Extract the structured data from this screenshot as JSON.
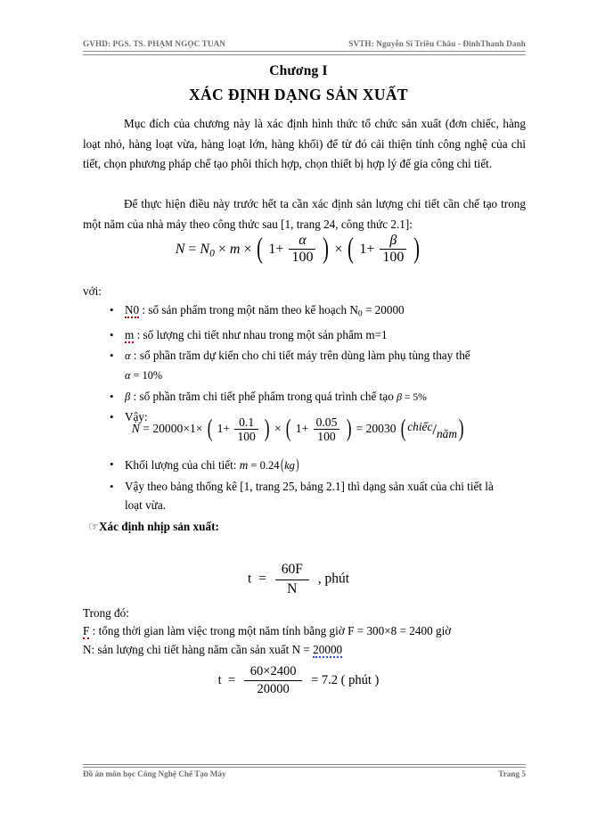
{
  "header": {
    "left": "GVHD: PGS. TS. PHẠM NGỌC TUAN",
    "right": "SVTH: Nguyễn Sĩ Triều Châu - ĐinhThanh Danh"
  },
  "titles": {
    "chapter": "Chương I",
    "main": "XÁC ĐỊNH DẠNG SẢN XUẤT"
  },
  "paragraphs": {
    "p1": "Mục đích của chương này là xác định hình thức tổ chức sản xuất (đơn chiếc, hàng loạt nhỏ, hàng loạt vừa, hàng loạt lớn, hàng khối) để từ đó cải thiện tính công nghệ của chi tiết, chọn phương pháp chế tạo phôi thích hợp, chọn thiết bị hợp lý để gia công chi tiết.",
    "p2": "Để thực hiện điều này trước hết ta cần xác định sản lượng chi tiết cần chế tạo trong một năm của nhà máy theo công thức sau [1, trang 24, công thức 2.1]:",
    "voi": "với:"
  },
  "formula_main": {
    "lhs": "N",
    "equals": "=",
    "n0": "N",
    "n0_sub": "0",
    "times1": "×",
    "m": "m",
    "times2": "×",
    "one_a": "1+",
    "alpha": "α",
    "hundred_a": "100",
    "times3": "×",
    "one_b": "1+",
    "beta": "β",
    "hundred_b": "100"
  },
  "bullets": [
    {
      "symbol": "N0",
      "sub": "0",
      "text_after": " : số sản phẩm trong một năm theo kế hoạch N",
      "tail_sub": "0",
      "tail": " = 20000",
      "spell": "red"
    },
    {
      "symbol": "m",
      "text_after": " : số lượng chi tiết như nhau trong một sản phẩm m=1",
      "spell": "red"
    },
    {
      "symbol": "α",
      "text_after": " : số phần trăm dự kiến cho chi tiết máy trên dùng làm phụ tùng thay thế",
      "cont_symbol": "α",
      "cont_value": " = 10%"
    },
    {
      "symbol": "β",
      "text_after": " : số phần trăm chi tiết phế phẩm trong quá trình chế tạo  ",
      "cont_symbol": "β",
      "cont_value": " = 5%"
    },
    {
      "text_plain": "Vậy:"
    }
  ],
  "formula_numeric": {
    "lhs": "N",
    "equals": "=",
    "n0_val": "20000",
    "times1": "×",
    "m_val": "1",
    "times2": "×",
    "one_a": "1+",
    "alpha_val": "0.1",
    "hundred_a": "100",
    "times3": "×",
    "one_b": "1+",
    "beta_val": "0.05",
    "hundred_b": "100",
    "result_eq": "=",
    "result": "20030",
    "unit_num": "chiếc",
    "unit_den": "năm"
  },
  "bullets2": [
    {
      "label": "Khối lượng của chi tiết: ",
      "m": "m",
      "eq": " = 0.24",
      "unit": "kg"
    },
    {
      "text": " Vậy theo bảng thống kê [1, trang 25, bảng 2.1] thì dạng sản xuất của chi tiết là",
      "cont": "loạt vừa."
    }
  ],
  "section_nhip": {
    "glyph": "☜",
    "label": "Xác định nhịp sản xuất:"
  },
  "formula_t1": {
    "t": "t",
    "equals": "=",
    "num": "60F",
    "den": "N",
    "unit": ", phút"
  },
  "trong_do": {
    "label": "Trong đó:",
    "line_F_symbol": "F",
    "line_F_text": " : tổng thời gian làm việc trong một năm tính bằng giờ F = 300×8 = 2400 giờ",
    "line_N_text": "N: sản lượng chi tiết hàng năm cần sản xuất N =  ",
    "line_N_value": "20000"
  },
  "formula_t2": {
    "t": "t",
    "equals": "=",
    "num": "60×2400",
    "den": "20000",
    "result_eq": "= 7.2",
    "unit": "( phút )"
  },
  "footer": {
    "left": "Đồ án môn học Công Nghệ Chế Tạo Máy",
    "right": "Trang 5"
  },
  "colors": {
    "text": "#000000",
    "header_gray": "#6e6e6e",
    "rule_gray": "#8c8c8c",
    "spell_red": "#c00000",
    "spell_blue": "#2a4bd0",
    "page_bg": "#ffffff"
  }
}
